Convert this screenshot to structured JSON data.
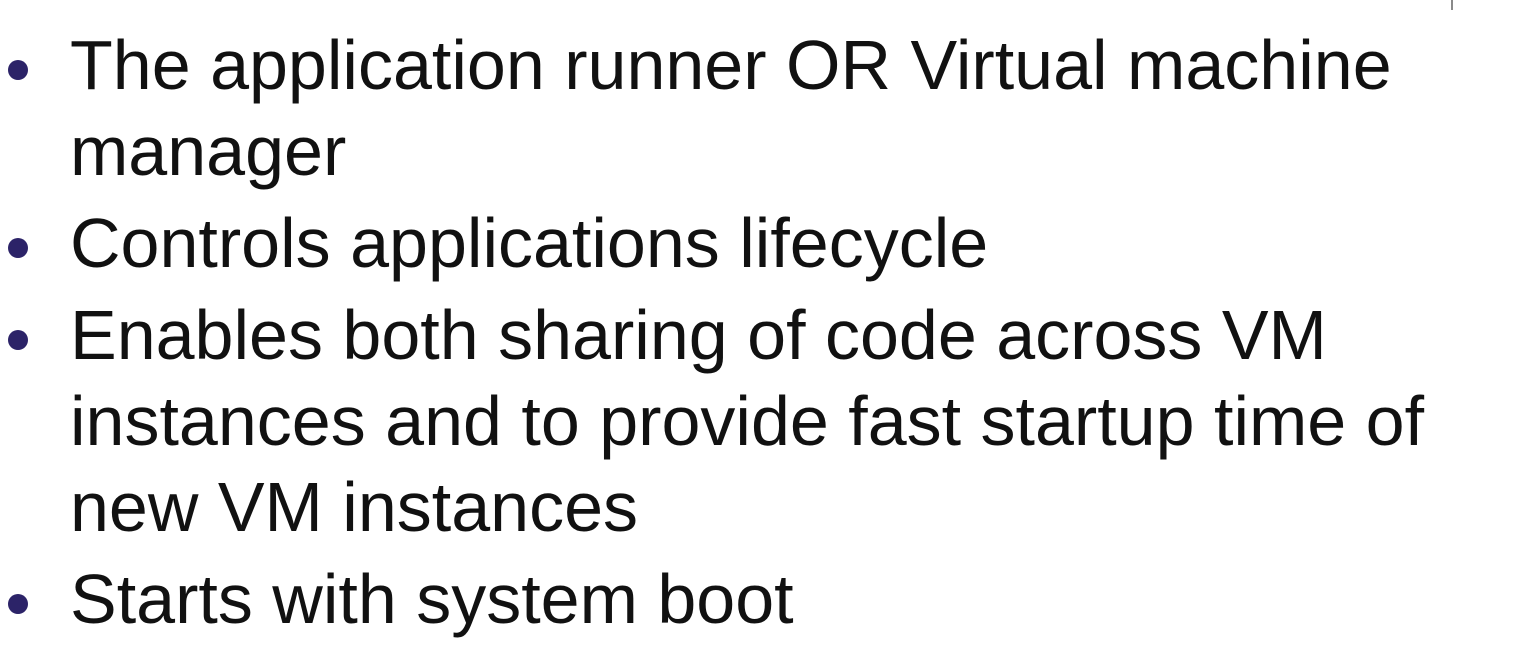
{
  "slide": {
    "bullets": [
      {
        "text": "The application runner OR Virtual machine manager"
      },
      {
        "text": "Controls applications lifecycle"
      },
      {
        "text": "Enables both sharing of code across VM instances and to provide fast startup time of new VM instances"
      },
      {
        "text": "Starts with system boot"
      }
    ]
  },
  "colors": {
    "bullet": "#2c2368",
    "text": "#111111",
    "background": "#ffffff"
  }
}
